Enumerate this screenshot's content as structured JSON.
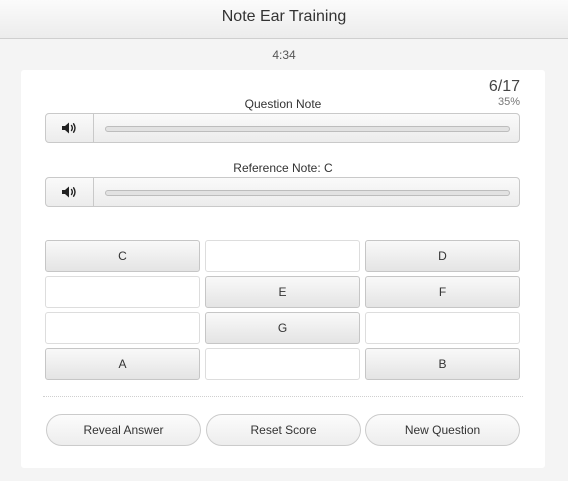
{
  "header": {
    "title": "Note Ear Training"
  },
  "timer": "4:34",
  "score": {
    "count": "6/17",
    "percent": "35%"
  },
  "players": {
    "question": {
      "label": "Question Note",
      "icon": "speaker-icon"
    },
    "reference": {
      "label": "Reference Note: C",
      "icon": "speaker-icon"
    }
  },
  "notes": {
    "c": "C",
    "d": "D",
    "e": "E",
    "f": "F",
    "g": "G",
    "a": "A",
    "b": "B"
  },
  "actions": {
    "reveal": "Reveal Answer",
    "reset": "Reset Score",
    "new": "New Question"
  }
}
